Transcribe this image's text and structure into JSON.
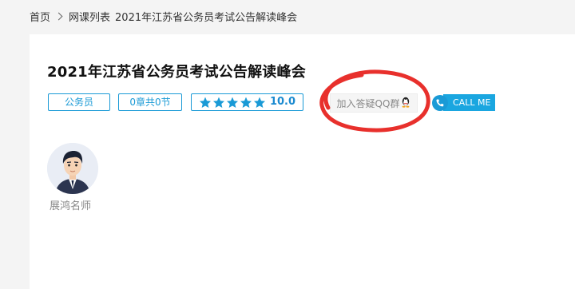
{
  "breadcrumb": {
    "home": "首页",
    "list": "网课列表",
    "current": "2021年江苏省公务员考试公告解读峰会"
  },
  "course": {
    "title": "2021年江苏省公务员考试公告解读峰会",
    "category": "公务员",
    "chapters": "0章共0节",
    "rating": {
      "stars": 5,
      "score": "10.0"
    },
    "qq_button_label": "加入答疑QQ群",
    "call_button_label": "CALL ME"
  },
  "teacher": {
    "name": "展鸿名师"
  },
  "colors": {
    "accent": "#1a9ad6",
    "annotation": "#e8302c"
  },
  "icons": {
    "star": "star-icon",
    "qq": "qq-penguin-icon",
    "phone": "phone-icon"
  }
}
